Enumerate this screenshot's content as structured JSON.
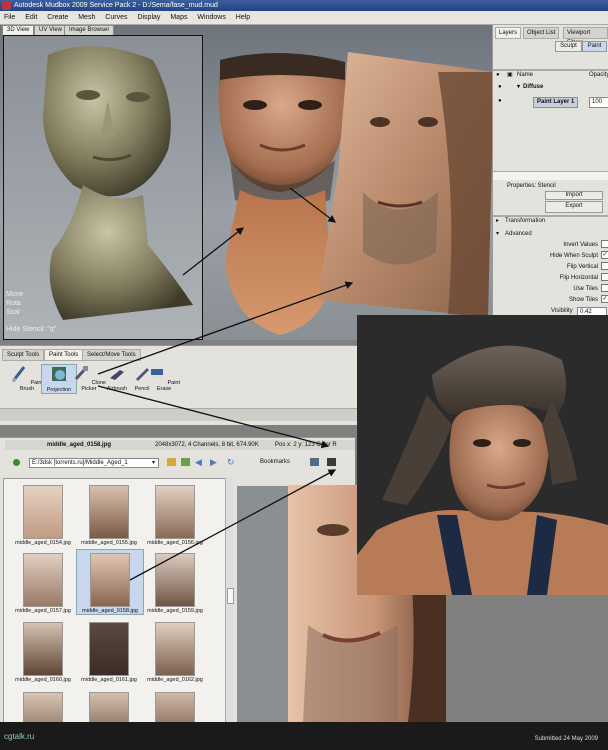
{
  "window": {
    "title": "Autodesk Mudbox 2009 Service Pack 2 - D:/Sema/fase_mud.mud"
  },
  "menu": [
    "File",
    "Edit",
    "Create",
    "Mesh",
    "Curves",
    "Display",
    "Maps",
    "Windows",
    "Help"
  ],
  "viewport": {
    "tabs": [
      "3D View",
      "UV View",
      "Image Browser"
    ],
    "overlay_lines": [
      "Move",
      "Rota",
      "Scal"
    ],
    "hide_stencil": "Hide Stencil: \"q\""
  },
  "layers_panel": {
    "tabs": [
      "Layers",
      "Object List",
      "Viewport Filters"
    ],
    "mode_buttons": [
      "Sculpt",
      "Paint"
    ],
    "columns": [
      "Name",
      "Opacity"
    ],
    "group": "Diffuse",
    "layer_name": "Paint Layer 1",
    "layer_opacity": "100"
  },
  "properties": {
    "title": "Properties: Stencil",
    "import_label": "Import",
    "export_label": "Export",
    "transformation": "Transformation",
    "advanced": "Advanced",
    "options": [
      {
        "label": "Invert Values",
        "checked": false
      },
      {
        "label": "Hide When Sculpt",
        "checked": true
      },
      {
        "label": "Flip Vertical",
        "checked": false
      },
      {
        "label": "Flip Horizontal",
        "checked": false
      },
      {
        "label": "Use Tiles",
        "checked": false
      },
      {
        "label": "Show Tiles",
        "checked": true
      }
    ],
    "visibility_label": "Visibility",
    "visibility_value": "0.42"
  },
  "tool_tray": {
    "tabs": [
      "Sculpt Tools",
      "Paint Tools",
      "Select/Move Tools"
    ],
    "tools": [
      "Paint Brush",
      "Projection",
      "Clone Picker",
      "Airbrush",
      "Pencil",
      "Paint Erase"
    ]
  },
  "image_browser": {
    "file_name": "middle_aged_0158.jpg",
    "file_info": "2048x3072, 4 Channels, 8 bit, 674.90K",
    "pos_info": "Pos x: 2 y: 123 Color R",
    "path": "E:/3dsk [torrents.ru]/Middle_Aged_1",
    "bookmarks": "Bookmarks",
    "thumbnails": [
      "middle_aged_0154.jpg",
      "middle_aged_0155.jpg",
      "middle_aged_0156.jpg",
      "middle_aged_0157.jpg",
      "middle_aged_0158.jpg",
      "middle_aged_0159.jpg",
      "middle_aged_0160.jpg",
      "middle_aged_0161.jpg",
      "middle_aged_0162.jpg"
    ]
  },
  "footer": {
    "logo": "cgtalk.ru",
    "submitted": "Submitted 24 May 2009"
  },
  "colors": {
    "skin": "#c79a7c",
    "sculpt": "#8a8566",
    "title_blue": "#2b4f8c",
    "hat": "#4a3f36"
  }
}
